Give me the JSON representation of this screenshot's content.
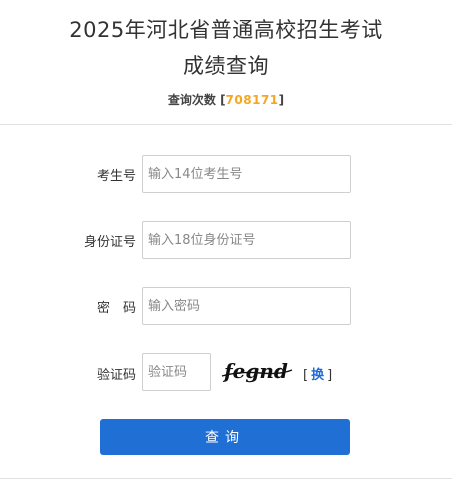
{
  "header": {
    "title_line1": "2025年河北省普通高校招生考试",
    "title_line2": "成绩查询",
    "count_label": "查询次数",
    "count_value": "708171",
    "bracket_open": "[",
    "bracket_close": "]"
  },
  "form": {
    "exam_number": {
      "label": "考生号",
      "placeholder": "输入14位考生号",
      "value": ""
    },
    "id_number": {
      "label": "身份证号",
      "placeholder": "输入18位身份证号",
      "value": ""
    },
    "password": {
      "label": "密　码",
      "placeholder": "输入密码",
      "value": ""
    },
    "captcha": {
      "label": "验证码",
      "placeholder": "验证码",
      "value": "",
      "image_text": "fegnd"
    },
    "refresh_label": "换",
    "submit_label": "查询"
  },
  "colors": {
    "accent": "#1f6fd5",
    "count": "#f5a623",
    "link": "#1e6bd6"
  }
}
